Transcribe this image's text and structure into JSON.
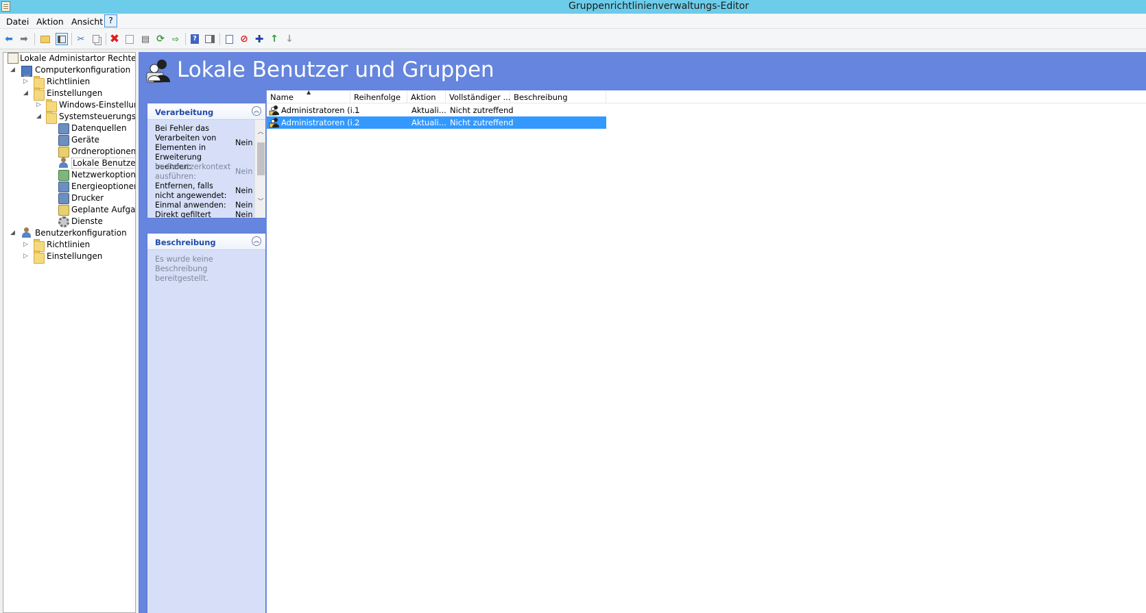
{
  "window": {
    "title": "Gruppenrichtlinienverwaltungs-Editor"
  },
  "menu": {
    "file": "Datei",
    "action": "Aktion",
    "view": "Ansicht",
    "help": "?"
  },
  "tree": {
    "root": "Lokale Administartor Rechte GP",
    "computer": "Computerkonfiguration",
    "c_policies": "Richtlinien",
    "c_settings": "Einstellungen",
    "windows_settings": "Windows-Einstellung",
    "control_panel": "Systemsteuerungseir",
    "data_sources": "Datenquellen",
    "devices": "Geräte",
    "folder_options": "Ordneroptionen",
    "local_users": "Lokale Benutzer u",
    "network_options": "Netzwerkoptione",
    "power_options": "Energieoptionen",
    "printers": "Drucker",
    "scheduled_tasks": "Geplante Aufgab",
    "services": "Dienste",
    "user": "Benutzerkonfiguration",
    "u_policies": "Richtlinien",
    "u_settings": "Einstellungen"
  },
  "header": {
    "title": "Lokale Benutzer und Gruppen"
  },
  "processing": {
    "title": "Verarbeitung",
    "rows": [
      {
        "label": "Bei Fehler das Verarbeiten von Elementen in Erweiterung beenden:",
        "value": "Nein"
      },
      {
        "label": "Im Benutzerkontext ausführen:",
        "value": "Nein"
      },
      {
        "label": "Entfernen, falls nicht angewendet:",
        "value": "Nein"
      },
      {
        "label": "Einmal anwenden:",
        "value": "Nein"
      },
      {
        "label": "Direkt gefiltert",
        "value": "Nein"
      }
    ]
  },
  "description": {
    "title": "Beschreibung",
    "text": "Es wurde keine Beschreibung bereitgestellt."
  },
  "list": {
    "columns": [
      "Name",
      "Reihenfolge",
      "Aktion",
      "Vollständiger ...",
      "Beschreibung"
    ],
    "rows": [
      {
        "name": "Administratoren (i...",
        "order": "1",
        "action": "Aktuali...",
        "full": "Nicht zutreffend",
        "desc": ""
      },
      {
        "name": "Administratoren (i...",
        "order": "2",
        "action": "Aktuali...",
        "full": "Nicht zutreffend",
        "desc": ""
      }
    ]
  },
  "icons": {
    "back": "back-arrow-icon",
    "forward": "forward-arrow-icon",
    "delete": "delete-x-icon",
    "stop": "stop-icon",
    "add": "plus-icon",
    "up": "move-up-icon",
    "down": "move-down-icon"
  },
  "colors": {
    "titlebar": "#6ccce9",
    "pane": "#6585de",
    "selection": "#3399ff"
  }
}
